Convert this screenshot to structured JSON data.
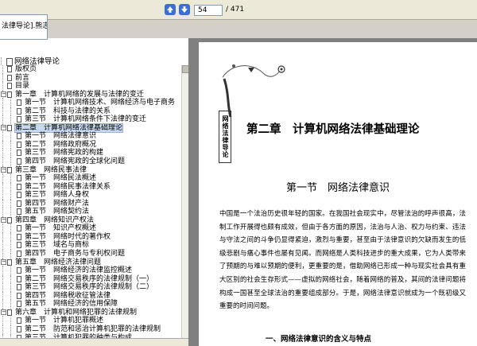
{
  "toolbar": {
    "doc_tab_title": "法律导论].熊志海.文...",
    "page_current": "54",
    "page_total": "/ 471"
  },
  "tree": {
    "root": "网络法律导论",
    "items": [
      {
        "level": 1,
        "expand": "",
        "text": "版权页"
      },
      {
        "level": 1,
        "expand": "",
        "text": "前言"
      },
      {
        "level": 1,
        "expand": "",
        "text": "目录"
      },
      {
        "level": 1,
        "expand": "-",
        "text": "第一章　计算机网络的发展与法律的变迁"
      },
      {
        "level": 2,
        "expand": "",
        "text": "第一节　计算机网络技术、网络经济与电子商务"
      },
      {
        "level": 2,
        "expand": "",
        "text": "第二节　科技与法律的关系"
      },
      {
        "level": 2,
        "expand": "",
        "text": "第三节　计算机网络条件下法律的变迁"
      },
      {
        "level": 1,
        "expand": "-",
        "text": "第二章　计算机网络法律基础理论",
        "selected": true
      },
      {
        "level": 2,
        "expand": "",
        "text": "第一节　网络法律意识"
      },
      {
        "level": 2,
        "expand": "",
        "text": "第二节　网络政府概况"
      },
      {
        "level": 2,
        "expand": "",
        "text": "第三节　网络宪政的构建"
      },
      {
        "level": 2,
        "expand": "",
        "text": "第四节　网络宪政的全球化问题"
      },
      {
        "level": 1,
        "expand": "-",
        "text": "第三章　网络民事法律"
      },
      {
        "level": 2,
        "expand": "",
        "text": "第一节　网络民法概述"
      },
      {
        "level": 2,
        "expand": "",
        "text": "第二节　网络民事法律关系"
      },
      {
        "level": 2,
        "expand": "",
        "text": "第三节　网络人身权"
      },
      {
        "level": 2,
        "expand": "",
        "text": "第四节　网络财产法"
      },
      {
        "level": 2,
        "expand": "",
        "text": "第五节　网络契约法"
      },
      {
        "level": 1,
        "expand": "-",
        "text": "第四章　网络知识产权法"
      },
      {
        "level": 2,
        "expand": "",
        "text": "第一节　知识产权概述"
      },
      {
        "level": 2,
        "expand": "",
        "text": "第二节　网络时代的著作权"
      },
      {
        "level": 2,
        "expand": "",
        "text": "第三节　域名与商标"
      },
      {
        "level": 2,
        "expand": "",
        "text": "第四节　电子商务与专利权问题"
      },
      {
        "level": 1,
        "expand": "-",
        "text": "第五章　网络经济法律问题"
      },
      {
        "level": 2,
        "expand": "",
        "text": "第一节　网络经济的法律监控概述"
      },
      {
        "level": 2,
        "expand": "",
        "text": "第二节　网络交易秩序的法律规制（一）"
      },
      {
        "level": 2,
        "expand": "",
        "text": "第三节　网络交易秩序的法律规制（二）"
      },
      {
        "level": 2,
        "expand": "",
        "text": "第四节　网络税收征管法律"
      },
      {
        "level": 2,
        "expand": "",
        "text": "第五节　网络经济的信用保障"
      },
      {
        "level": 1,
        "expand": "-",
        "text": "第六章　计算机和网络犯罪的法律规制"
      },
      {
        "level": 2,
        "expand": "",
        "text": "第一节　计算机犯罪概述"
      },
      {
        "level": 2,
        "expand": "",
        "text": "第二节　防范和惩治计算机犯罪的法律规制"
      },
      {
        "level": 2,
        "expand": "",
        "text": "第三节　计算机犯罪的种类与构成"
      }
    ]
  },
  "page": {
    "vertical_title": "网络法律导论",
    "chapter_title": "第二章　计算机网络法律基础理论",
    "section_title": "第一节　网络法律意识",
    "paragraph": "中国是一个法治历史很年轻的国家。在我国社会现实中，尽管法治的呼声很高，法制工作开展得也颇有成效，但由于各方面的原因，法治与人治、权力与约束、违法与守法之间的斗争仍显得紧迫，激烈与重要，甚至由于法律意识的欠缺而发生的低级悲剧与痛心事件也屡有见闻。而网络是人类科技进步的重大成果，它为人类带来了预期的与难以预期的便利，更重要的是，借助网络已形成一种与现实社会具有重大区别的社会生存形式——虚拟的网络社会，随着网络的普及，其间的法律问题将构成一国甚至全球法治的重要组成部分。于是，网络法律意识就成为一个既初级又重要的时间问题。",
    "subheading": "一、网络法律意识的含义与特点"
  },
  "colors": {
    "nav_button": "#3a6fd8",
    "selection": "#c8d8f0",
    "viewer_background": "#808080"
  }
}
